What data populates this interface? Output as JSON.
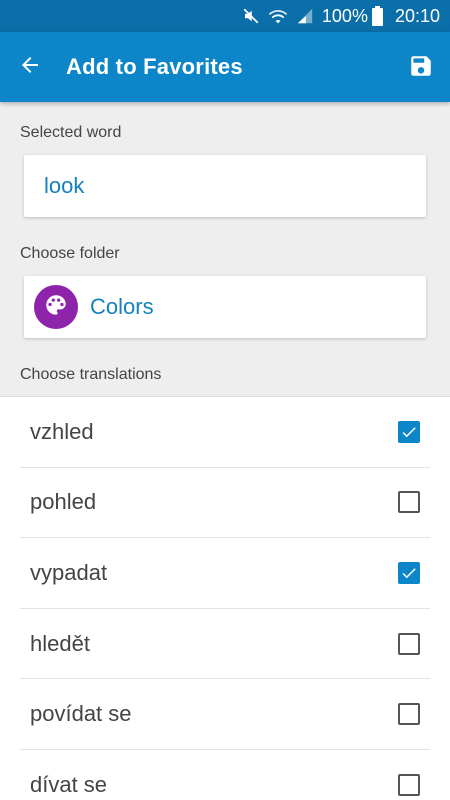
{
  "status_bar": {
    "battery": "100%",
    "time": "20:10",
    "icons": [
      "mute-icon",
      "wifi-icon",
      "signal-icon",
      "battery-icon"
    ]
  },
  "app_bar": {
    "title": "Add to Favorites",
    "back_icon": "arrow-back-icon",
    "save_icon": "save-icon",
    "color": "#0d86c9"
  },
  "selected_word": {
    "label": "Selected word",
    "value": "look"
  },
  "folder": {
    "label": "Choose folder",
    "name": "Colors",
    "icon": "palette-icon",
    "icon_color": "#8e24aa"
  },
  "translations": {
    "label": "Choose translations",
    "items": [
      {
        "text": "vzhled",
        "checked": true
      },
      {
        "text": "pohled",
        "checked": false
      },
      {
        "text": "vypadat",
        "checked": true
      },
      {
        "text": "hledět",
        "checked": false
      },
      {
        "text": "povídat se",
        "checked": false
      },
      {
        "text": "dívat se",
        "checked": false
      }
    ]
  }
}
